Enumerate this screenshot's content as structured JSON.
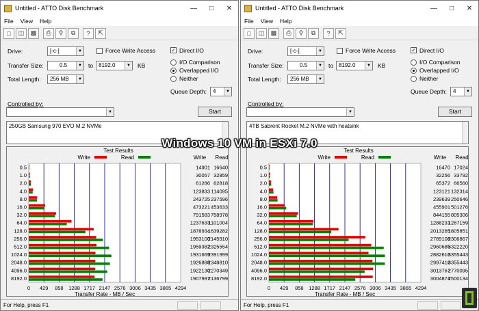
{
  "overlay_caption": "Windows 10 VM in ESXi 7.0",
  "windows": [
    {
      "title": "Untitled - ATTO Disk Benchmark",
      "menus": [
        "File",
        "View",
        "Help"
      ],
      "labels": {
        "drive": "Drive:",
        "transfer_size": "Transfer Size:",
        "to": "to",
        "kb": "KB",
        "total_length": "Total Length:",
        "force_write": "Force Write Access",
        "direct_io": "Direct I/O",
        "io_comparison": "I/O Comparison",
        "overlapped_io": "Overlapped I/O",
        "neither": "Neither",
        "queue_depth": "Queue Depth:",
        "controlled_by": "Controlled by:",
        "start": "Start"
      },
      "drive_value": "[-c-]",
      "transfer_from": "0.5",
      "transfer_to": "8192.0",
      "total_length_value": "256 MB",
      "queue_depth_value": "4",
      "force_write_checked": false,
      "direct_io_checked": true,
      "io_mode": "Overlapped I/O",
      "controlled_by_value": "",
      "description": "250GB Samsung 970 EVO M.2 NVMe",
      "status": "For Help, press F1"
    },
    {
      "title": "Untitled - ATTO Disk Benchmark",
      "menus": [
        "File",
        "View",
        "Help"
      ],
      "labels": {
        "drive": "Drive:",
        "transfer_size": "Transfer Size:",
        "to": "to",
        "kb": "KB",
        "total_length": "Total Length:",
        "force_write": "Force Write Access",
        "direct_io": "Direct I/O",
        "io_comparison": "I/O Comparison",
        "overlapped_io": "Overlapped I/O",
        "neither": "Neither",
        "queue_depth": "Queue Depth:",
        "controlled_by": "Controlled by:",
        "start": "Start"
      },
      "drive_value": "[-c-]",
      "transfer_from": "0.5",
      "transfer_to": "8192.0",
      "total_length_value": "256 MB",
      "queue_depth_value": "4",
      "force_write_checked": false,
      "direct_io_checked": true,
      "io_mode": "Overlapped I/O",
      "controlled_by_value": "",
      "description": "4TB Sabrent Rocket M.2 NVMe with heatsink",
      "status": "For Help, press F1"
    }
  ],
  "chart_data": [
    {
      "type": "bar",
      "title": "Test Results",
      "xlabel": "Transfer Rate - MB / Sec",
      "ylabel": "",
      "xlim": [
        0,
        4294
      ],
      "xticks": [
        "0",
        "429",
        "858",
        "1288",
        "1717",
        "2147",
        "2576",
        "3006",
        "3435",
        "3865",
        "4294"
      ],
      "colors": {
        "Write": "#e00000",
        "Read": "#008000"
      },
      "columns": [
        "Write",
        "Read"
      ],
      "categories": [
        "0.5",
        "1.0",
        "2.0",
        "4.0",
        "8.0",
        "16.0",
        "32.0",
        "64.0",
        "128.0",
        "256.0",
        "512.0",
        "1024.0",
        "2048.0",
        "4096.0",
        "8192.0"
      ],
      "series": [
        {
          "name": "Write",
          "values": [
            14901,
            30057,
            61286,
            123833,
            243725,
            473221,
            791583,
            1237633,
            1878934,
            1953100,
            1959382,
            1931669,
            1926888,
            1922130,
            1907997
          ]
        },
        {
          "name": "Read",
          "values": [
            16640,
            32859,
            62818,
            114095,
            237596,
            453633,
            758978,
            1101004,
            1639282,
            2145910,
            2325554,
            2391999,
            2348810,
            2270349,
            2136799
          ]
        }
      ]
    },
    {
      "type": "bar",
      "title": "Test Results",
      "xlabel": "Transfer Rate - MB / Sec",
      "ylabel": "",
      "xlim": [
        0,
        4294
      ],
      "xticks": [
        "0",
        "429",
        "858",
        "1288",
        "1717",
        "2147",
        "2576",
        "3006",
        "3435",
        "3865",
        "4294"
      ],
      "colors": {
        "Write": "#e00000",
        "Read": "#008000"
      },
      "columns": [
        "Write",
        "Read"
      ],
      "categories": [
        "0.5",
        "1.0",
        "2.0",
        "4.0",
        "8.0",
        "16.0",
        "32.0",
        "64.0",
        "128.0",
        "256.0",
        "512.0",
        "1024.0",
        "2048.0",
        "4096.0",
        "8192.0"
      ],
      "series": [
        {
          "name": "Write",
          "values": [
            16470,
            32256,
            65372,
            123121,
            239639,
            455901,
            844155,
            1288231,
            2013265,
            2789108,
            2960685,
            2882616,
            2997418,
            3013767,
            3004874
          ]
        },
        {
          "name": "Read",
          "values": [
            17024,
            33792,
            66560,
            132314,
            250646,
            501276,
            805306,
            1267159,
            1805851,
            2306867,
            3322220,
            3355443,
            3355443,
            2770095,
            2500134
          ]
        }
      ]
    }
  ]
}
